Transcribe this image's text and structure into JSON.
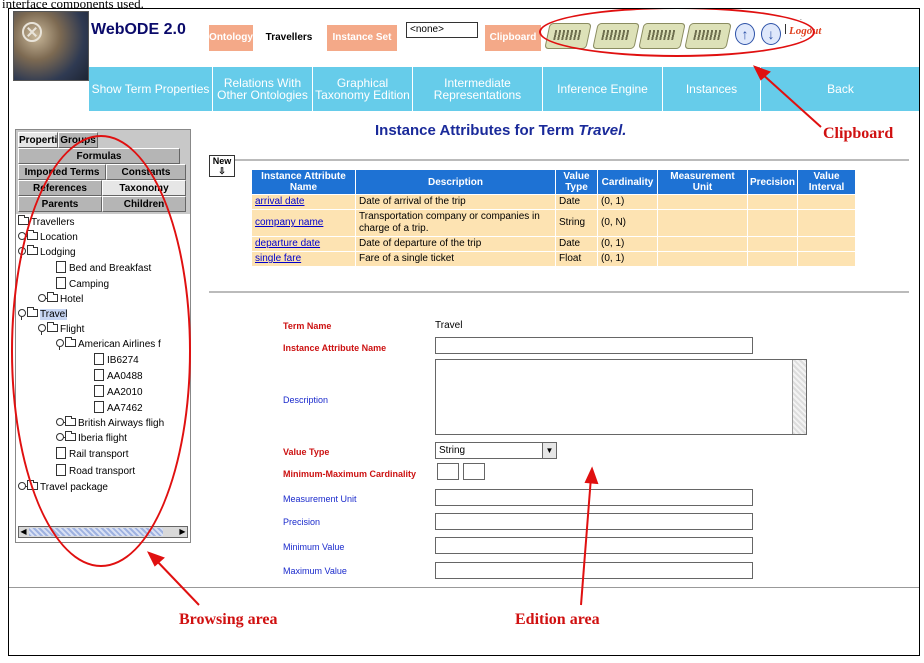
{
  "caption": "interface components used.",
  "header": {
    "app_title": "WebODE 2.0",
    "ontology_btn": "Ontology",
    "ontology_name": "Travellers",
    "instance_set_btn": "Instance Set",
    "instance_set_value": "<none>",
    "clipboard_btn": "Clipboard",
    "logout": "Logout",
    "up_icon": "up-arrow-icon",
    "down_icon": "down-arrow-icon"
  },
  "nav": [
    {
      "label": "Show Term Properties"
    },
    {
      "label": "Relations With Other Ontologies"
    },
    {
      "label": "Graphical Taxonomy Edition"
    },
    {
      "label": "Intermediate Representations"
    },
    {
      "label": "Inference Engine"
    },
    {
      "label": "Instances"
    },
    {
      "label": "Back"
    }
  ],
  "left": {
    "tabs": {
      "properties": "Properties",
      "groups": "Groups",
      "formulas": "Formulas",
      "imported_terms": "Imported Terms",
      "constants": "Constants",
      "references": "References",
      "taxonomy": "Taxonomy",
      "parents": "Parents",
      "children": "Children"
    },
    "tree": [
      "Travellers",
      "Location",
      "Lodging",
      "Bed and Breakfast",
      "Camping",
      "Hotel",
      "Travel",
      "Flight",
      "American Airlines f",
      "IB6274",
      "AA0488",
      "AA2010",
      "AA7462",
      "British Airways fligh",
      "Iberia flight",
      "Rail transport",
      "Road transport",
      "Travel package"
    ]
  },
  "main": {
    "title_prefix": "Instance Attributes for Term ",
    "title_term": "Travel.",
    "new_btn": "New",
    "table": {
      "headers": [
        "Instance Attribute Name",
        "Description",
        "Value Type",
        "Cardinality",
        "Measurement Unit",
        "Precision",
        "Value Interval"
      ],
      "rows": [
        [
          "arrival date",
          "Date of arrival of the trip",
          "Date",
          "(0, 1)",
          "",
          "",
          ""
        ],
        [
          "company name",
          "Transportation company or companies in charge of a trip.",
          "String",
          "(0, N)",
          "",
          "",
          ""
        ],
        [
          "departure date",
          "Date of departure of the trip",
          "Date",
          "(0, 1)",
          "",
          "",
          ""
        ],
        [
          "single fare",
          "Fare of a single ticket",
          "Float",
          "(0, 1)",
          "",
          "",
          ""
        ]
      ]
    },
    "form": {
      "term_name_label": "Term Name",
      "term_name_value": "Travel",
      "attr_name_label": "Instance Attribute Name",
      "description_label": "Description",
      "value_type_label": "Value Type",
      "value_type_value": "String",
      "cardinality_label": "Minimum-Maximum Cardinality",
      "measurement_label": "Measurement Unit",
      "precision_label": "Precision",
      "min_value_label": "Minimum Value",
      "max_value_label": "Maximum Value"
    }
  },
  "annotations": {
    "clipboard": "Clipboard",
    "browsing": "Browsing area",
    "edition": "Edition area"
  },
  "colors": {
    "nav_bg": "#66ccea",
    "header_btn_bg": "#f4a988",
    "table_header_bg": "#1e72d4",
    "table_row_bg": "#fde3b2",
    "annotation_red": "#d01010",
    "title_blue": "#1a2a9a"
  }
}
